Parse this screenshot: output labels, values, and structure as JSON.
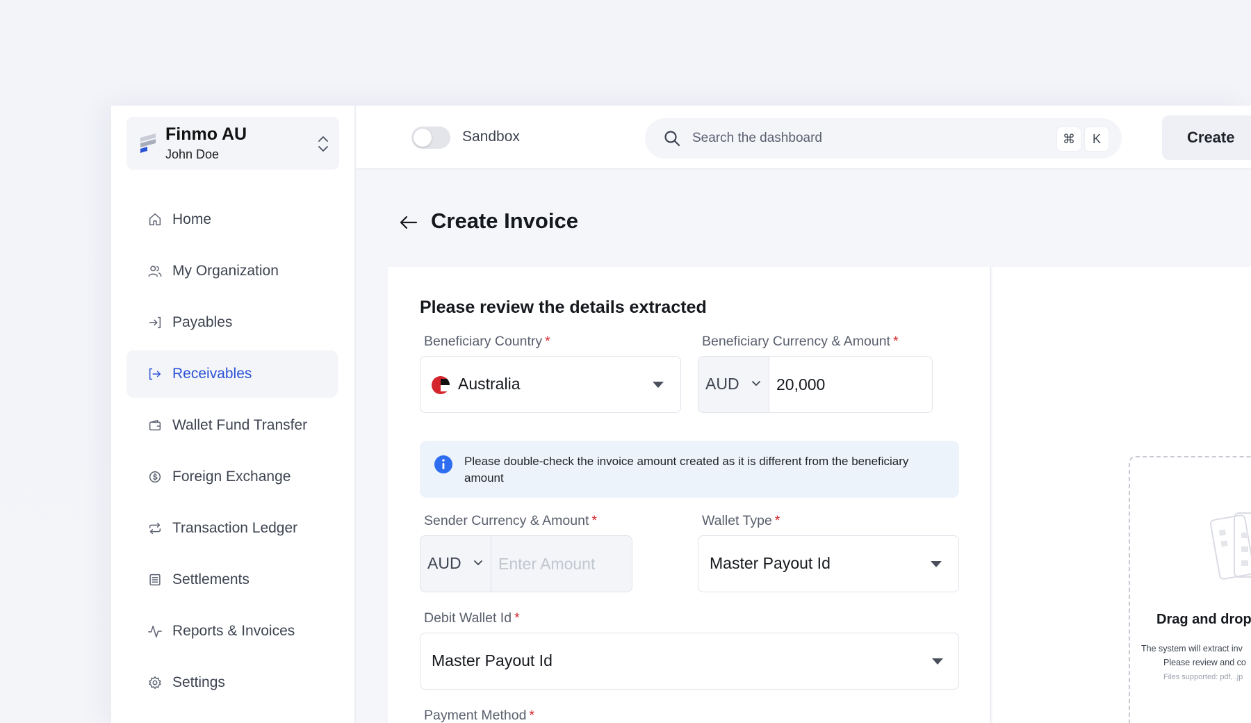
{
  "org": {
    "name": "Finmo AU",
    "user": "John Doe"
  },
  "sidebar": {
    "items": [
      {
        "label": "Home",
        "icon": "home-icon"
      },
      {
        "label": "My Organization",
        "icon": "users-icon"
      },
      {
        "label": "Payables",
        "icon": "sign-in-icon"
      },
      {
        "label": "Receivables",
        "icon": "sign-out-icon",
        "active": true
      },
      {
        "label": "Wallet Fund Transfer",
        "icon": "wallet-icon"
      },
      {
        "label": "Foreign Exchange",
        "icon": "exchange-icon"
      },
      {
        "label": "Transaction Ledger",
        "icon": "repeat-icon"
      },
      {
        "label": "Settlements",
        "icon": "list-icon"
      },
      {
        "label": "Reports & Invoices",
        "icon": "activity-icon"
      },
      {
        "label": "Settings",
        "icon": "gear-icon"
      }
    ]
  },
  "topbar": {
    "sandbox_label": "Sandbox",
    "search_placeholder": "Search the dashboard",
    "shortcut_key1": "⌘",
    "shortcut_key2": "K",
    "create_label": "Create"
  },
  "page": {
    "title": "Create Invoice"
  },
  "form": {
    "section_title": "Please review the details extracted",
    "beneficiary_country": {
      "label": "Beneficiary Country",
      "required": "*",
      "value": "Australia"
    },
    "beneficiary_amount": {
      "label": "Beneficiary Currency & Amount",
      "required": "*",
      "currency": "AUD",
      "value": "20,000"
    },
    "info_message": "Please double-check the invoice amount created as it is different from the beneficiary amount",
    "sender_amount": {
      "label": "Sender Currency & Amount",
      "required": "*",
      "currency": "AUD",
      "placeholder": "Enter Amount"
    },
    "wallet_type": {
      "label": "Wallet Type",
      "required": "*",
      "value": "Master Payout Id"
    },
    "debit_wallet": {
      "label": "Debit Wallet Id",
      "required": "*",
      "value": "Master Payout Id"
    },
    "payment_method": {
      "label": "Payment Method",
      "required": "*"
    }
  },
  "upload": {
    "title": "Drag and drop",
    "desc1": "The system will extract inv",
    "desc2": "Please review and co",
    "files": "Files supported: pdf, .jp"
  },
  "colors": {
    "accent": "#2b53d6",
    "required": "#d4242c",
    "info_bg": "#edf3fb",
    "info_icon": "#2f6df0"
  }
}
